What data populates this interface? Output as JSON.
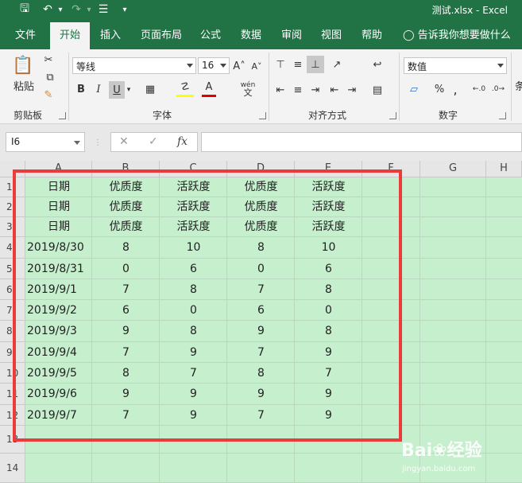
{
  "title": "测试.xlsx - Excel",
  "quick_access": {
    "save_icon": "🖫",
    "undo_icon": "↶",
    "redo_icon": "↷",
    "form_icon": "☰",
    "more_icon": "▾"
  },
  "tabs": [
    "文件",
    "开始",
    "插入",
    "页面布局",
    "公式",
    "数据",
    "审阅",
    "视图",
    "帮助"
  ],
  "active_tab": "开始",
  "tell_me": "告诉我你想要做什么",
  "ribbon": {
    "clipboard": {
      "label": "剪贴板",
      "paste": "粘贴"
    },
    "font": {
      "label": "字体",
      "font_name": "等线",
      "font_size": "16",
      "grow": "A˄",
      "shrink": "A˅",
      "bold": "B",
      "italic": "I",
      "underline": "U",
      "wen": "wén",
      "wen_sub": "文"
    },
    "alignment": {
      "label": "对齐方式"
    },
    "number": {
      "label": "数字",
      "format": "数值",
      "percent": "%",
      "comma": ","
    },
    "partial": "条"
  },
  "formula_bar": {
    "name_box": "I6",
    "cancel": "✕",
    "enter": "✓",
    "fx": "fx",
    "value": ""
  },
  "columns": [
    "A",
    "B",
    "C",
    "D",
    "E",
    "F",
    "G",
    "H"
  ],
  "rows": [
    "1",
    "2",
    "3",
    "4",
    "5",
    "6",
    "7",
    "8",
    "9",
    "10",
    "11",
    "12",
    "13",
    "14"
  ],
  "cells": [
    [
      "日期",
      "优质度",
      "活跃度",
      "优质度",
      "活跃度"
    ],
    [
      "日期",
      "优质度",
      "活跃度",
      "优质度",
      "活跃度"
    ],
    [
      "日期",
      "优质度",
      "活跃度",
      "优质度",
      "活跃度"
    ],
    [
      "2019/8/30",
      "8",
      "10",
      "8",
      "10"
    ],
    [
      "2019/8/31",
      "0",
      "6",
      "0",
      "6"
    ],
    [
      "2019/9/1",
      "7",
      "8",
      "7",
      "8"
    ],
    [
      "2019/9/2",
      "6",
      "0",
      "6",
      "0"
    ],
    [
      "2019/9/3",
      "9",
      "8",
      "9",
      "8"
    ],
    [
      "2019/9/4",
      "7",
      "9",
      "7",
      "9"
    ],
    [
      "2019/9/5",
      "8",
      "7",
      "8",
      "7"
    ],
    [
      "2019/9/6",
      "9",
      "9",
      "9",
      "9"
    ],
    [
      "2019/9/7",
      "7",
      "9",
      "7",
      "9"
    ]
  ],
  "watermark": {
    "brand": "Bai❀经验",
    "url": "jingyan.baidu.com"
  },
  "colors": {
    "excel_green": "#217346",
    "selection_fill": "#c6efce",
    "highlight": "#ec3b3b"
  }
}
